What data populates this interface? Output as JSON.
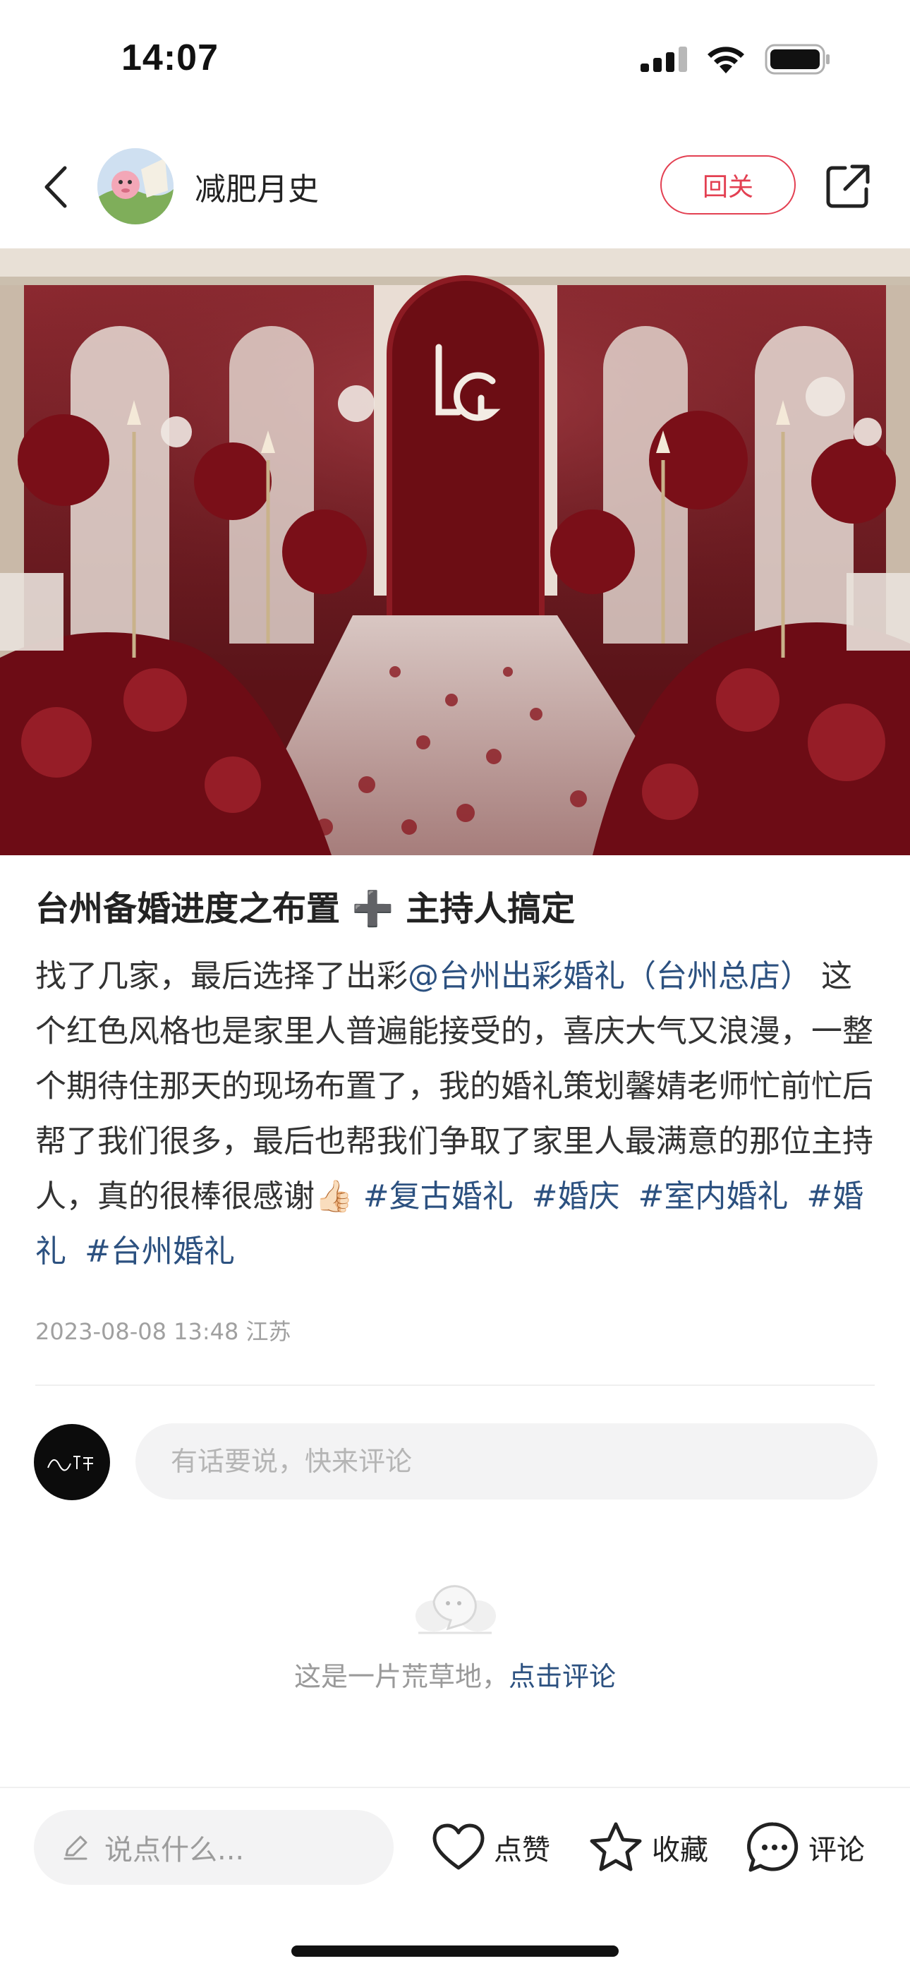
{
  "status_bar": {
    "time": "14:07",
    "icons": [
      "signal-icon",
      "wifi-icon",
      "battery-icon"
    ]
  },
  "header": {
    "author_name": "减肥月史",
    "follow_label": "回关",
    "icons": [
      "back-icon",
      "share-icon"
    ]
  },
  "photo": {
    "logo_letters": "LG"
  },
  "post": {
    "title": "台州备婚进度之布置 ➕ 主持人搞定",
    "body_intro": "找了几家，最后选择了出彩",
    "mention": "@台州出彩婚礼（台州总店）",
    "body_main": " 这个红色风格也是家里人普遍能接受的，喜庆大气又浪漫，一整个期待住那天的现场布置了，我的婚礼策划馨婧老师忙前忙后帮了我们很多，最后也帮我们争取了家里人最满意的那位主持人，真的很棒很感谢👍🏻 ",
    "tags": [
      "#复古婚礼",
      "#婚庆",
      "#室内婚礼",
      "#婚礼",
      "#台州婚礼"
    ],
    "date_location": "2023-08-08 13:48 江苏"
  },
  "comment_input": {
    "placeholder": "有话要说，快来评论",
    "avatar_text": "出彩婚礼"
  },
  "empty_state": {
    "text": "这是一片荒草地，",
    "link": "点击评论"
  },
  "bottom_bar": {
    "say_placeholder": "说点什么...",
    "like_label": "点赞",
    "collect_label": "收藏",
    "comment_label": "评论"
  },
  "colors": {
    "accent_red": "#e34052",
    "link_blue": "#2c5180"
  }
}
